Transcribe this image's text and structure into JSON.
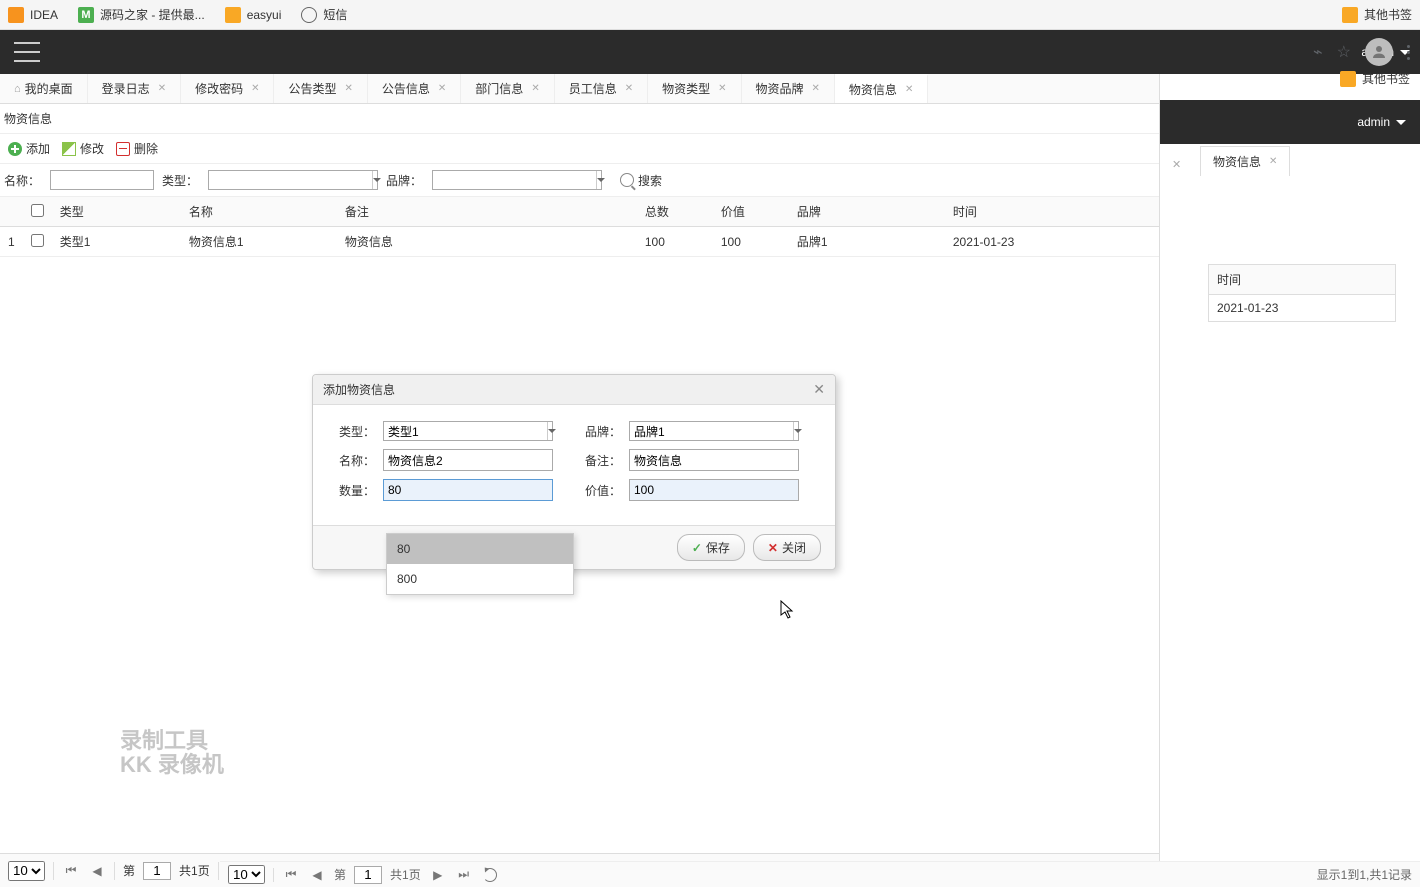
{
  "bookmarks": {
    "items": [
      {
        "label": "IDEA",
        "icon": "orange"
      },
      {
        "label": "源码之家 - 提供最...",
        "icon": "green",
        "glyph": "M"
      },
      {
        "label": "easyui",
        "icon": "yellow"
      },
      {
        "label": "短信",
        "icon": "globe"
      }
    ],
    "right_label": "其他书签"
  },
  "header": {
    "user": "admin"
  },
  "tabs": [
    {
      "label": "我的桌面",
      "icon": "home",
      "closable": false
    },
    {
      "label": "登录日志",
      "closable": true
    },
    {
      "label": "修改密码",
      "closable": true
    },
    {
      "label": "公告类型",
      "closable": true
    },
    {
      "label": "公告信息",
      "closable": true
    },
    {
      "label": "部门信息",
      "closable": true
    },
    {
      "label": "员工信息",
      "closable": true
    },
    {
      "label": "物资类型",
      "closable": true
    },
    {
      "label": "物资品牌",
      "closable": true
    },
    {
      "label": "物资信息",
      "closable": true,
      "active": true
    }
  ],
  "sub_header": "物资信息",
  "toolbar": {
    "add": "添加",
    "edit": "修改",
    "delete": "删除"
  },
  "filter": {
    "name_label": "名称：",
    "type_label": "类型：",
    "brand_label": "品牌：",
    "search_label": "搜索"
  },
  "table": {
    "headers": [
      "类型",
      "名称",
      "备注",
      "总数",
      "价值",
      "品牌",
      "时间"
    ],
    "rows": [
      {
        "idx": "1",
        "type": "类型1",
        "name": "物资信息1",
        "remark": "物资信息",
        "total": "100",
        "value": "100",
        "brand": "品牌1",
        "time": "2021-01-23"
      }
    ]
  },
  "pagination": {
    "page_label_prefix": "第",
    "page_num": "1",
    "total_pages_label": "共1页",
    "info": "显示1到1,共1记录"
  },
  "dialog": {
    "title": "添加物资信息",
    "type_label": "类型：",
    "type_value": "类型1",
    "brand_label": "品牌：",
    "brand_value": "品牌1",
    "name_label": "名称：",
    "name_value": "物资信息2",
    "remark_label": "备注：",
    "remark_value": "物资信息",
    "qty_label": "数量：",
    "qty_value": "80",
    "price_label": "价值：",
    "price_value": "100",
    "save": "保存",
    "close": "关闭"
  },
  "autocomplete": {
    "items": [
      "80",
      "800"
    ]
  },
  "right_pane": {
    "user": "admin",
    "tab_label": "物资信息",
    "bookmarks_label": "其他书签",
    "mini_table": {
      "header": "时间",
      "value": "2021-01-23"
    }
  },
  "pagination2": {
    "page_label_prefix": "第",
    "page_num": "1",
    "total_pages_label": "共1页",
    "info": "显示1到1,共1记录"
  },
  "watermark": {
    "line1": "录制工具",
    "line2": "KK 录像机"
  }
}
